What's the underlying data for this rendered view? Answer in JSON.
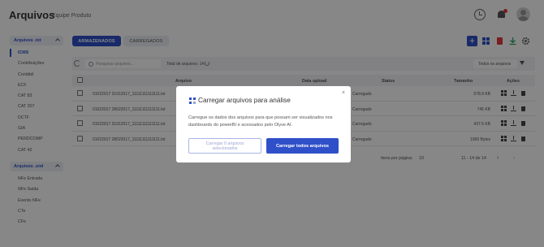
{
  "header": {
    "title": "Arquivos",
    "subtitle": "Equipe Produto",
    "icons": [
      "history-icon",
      "bell-icon",
      "avatar"
    ]
  },
  "sidebar": {
    "groups": [
      {
        "label": "Arquivos .txt",
        "items": [
          {
            "label": "ICMS",
            "active": true
          },
          {
            "label": "Contribuições"
          },
          {
            "label": "Contábil"
          },
          {
            "label": "ECF"
          },
          {
            "label": "CAT 83"
          },
          {
            "label": "CAT 207"
          },
          {
            "label": "DCTF"
          },
          {
            "label": "GIA"
          },
          {
            "label": "PERDCOMP"
          },
          {
            "label": "CAT 42"
          }
        ]
      },
      {
        "label": "Arquivos .xml",
        "items": [
          {
            "label": "NFe Entrada"
          },
          {
            "label": "NFe Saída"
          },
          {
            "label": "Evento NFe"
          },
          {
            "label": "CTe"
          },
          {
            "label": "CFe"
          }
        ]
      }
    ]
  },
  "tabs": [
    {
      "label": "ARMAZENADOS",
      "active": true
    },
    {
      "label": "CARREGADOS"
    }
  ],
  "toolbar": {
    "add_label": "+",
    "icons": [
      "add-icon",
      "grid-icon",
      "pdf-icon",
      "download-icon",
      "gear-icon"
    ]
  },
  "search": {
    "placeholder": "Pesquisar arquivos...",
    "total_label": "Total de arquivos: 14",
    "filter_label": "Todos os arquivos"
  },
  "table": {
    "columns": [
      "Arquivo",
      "Data upload",
      "Status",
      "Tamanho",
      "Ações"
    ],
    "rows": [
      {
        "file": "01022017 31012017_11111111111111.txt",
        "status": "Carregado",
        "size": "578.9 KB"
      },
      {
        "file": "01022017 28022017_11111111111111.txt",
        "status": "Carregado",
        "size": "745 KB"
      },
      {
        "file": "01022017 31012017_11111111111111.txt",
        "status": "Carregado",
        "size": "437.5 KB"
      },
      {
        "file": "01022017 28022017_11111111111111.txt",
        "status": "Carregado",
        "size": "1069 Bytes"
      }
    ],
    "footer": {
      "per_page_label": "Itens por página:",
      "per_page": "10",
      "range": "11 - 14 de 14"
    }
  },
  "modal": {
    "title": "Carregar arquivos para análise",
    "close": "×",
    "body": "Carregue os dados dos arquivos para que possam ser visualizados nos dashboards do powerBI e acessados pelo Olyve AI.",
    "btn_selected_line1": "Carregar 0 arquivos",
    "btn_selected_line2": "selecionados",
    "btn_all": "Carregar todos arquivos"
  },
  "colors": {
    "accent": "#2f50c9",
    "danger": "#e0393e",
    "success": "#38a169"
  }
}
